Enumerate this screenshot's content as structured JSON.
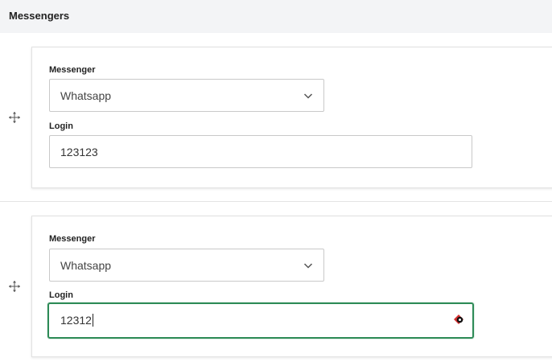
{
  "header": {
    "title": "Messengers"
  },
  "entries": [
    {
      "messenger_label": "Messenger",
      "messenger_value": "Whatsapp",
      "login_label": "Login",
      "login_value": "123123",
      "focused": false
    },
    {
      "messenger_label": "Messenger",
      "messenger_value": "Whatsapp",
      "login_label": "Login",
      "login_value": "12312",
      "focused": true
    }
  ],
  "icons": {
    "drag": "move-arrows-icon",
    "dropdown": "chevron-down-icon",
    "autofill": "password-manager-icon"
  },
  "colors": {
    "focus_border": "#2e8b57",
    "header_bg": "#f3f4f6"
  }
}
